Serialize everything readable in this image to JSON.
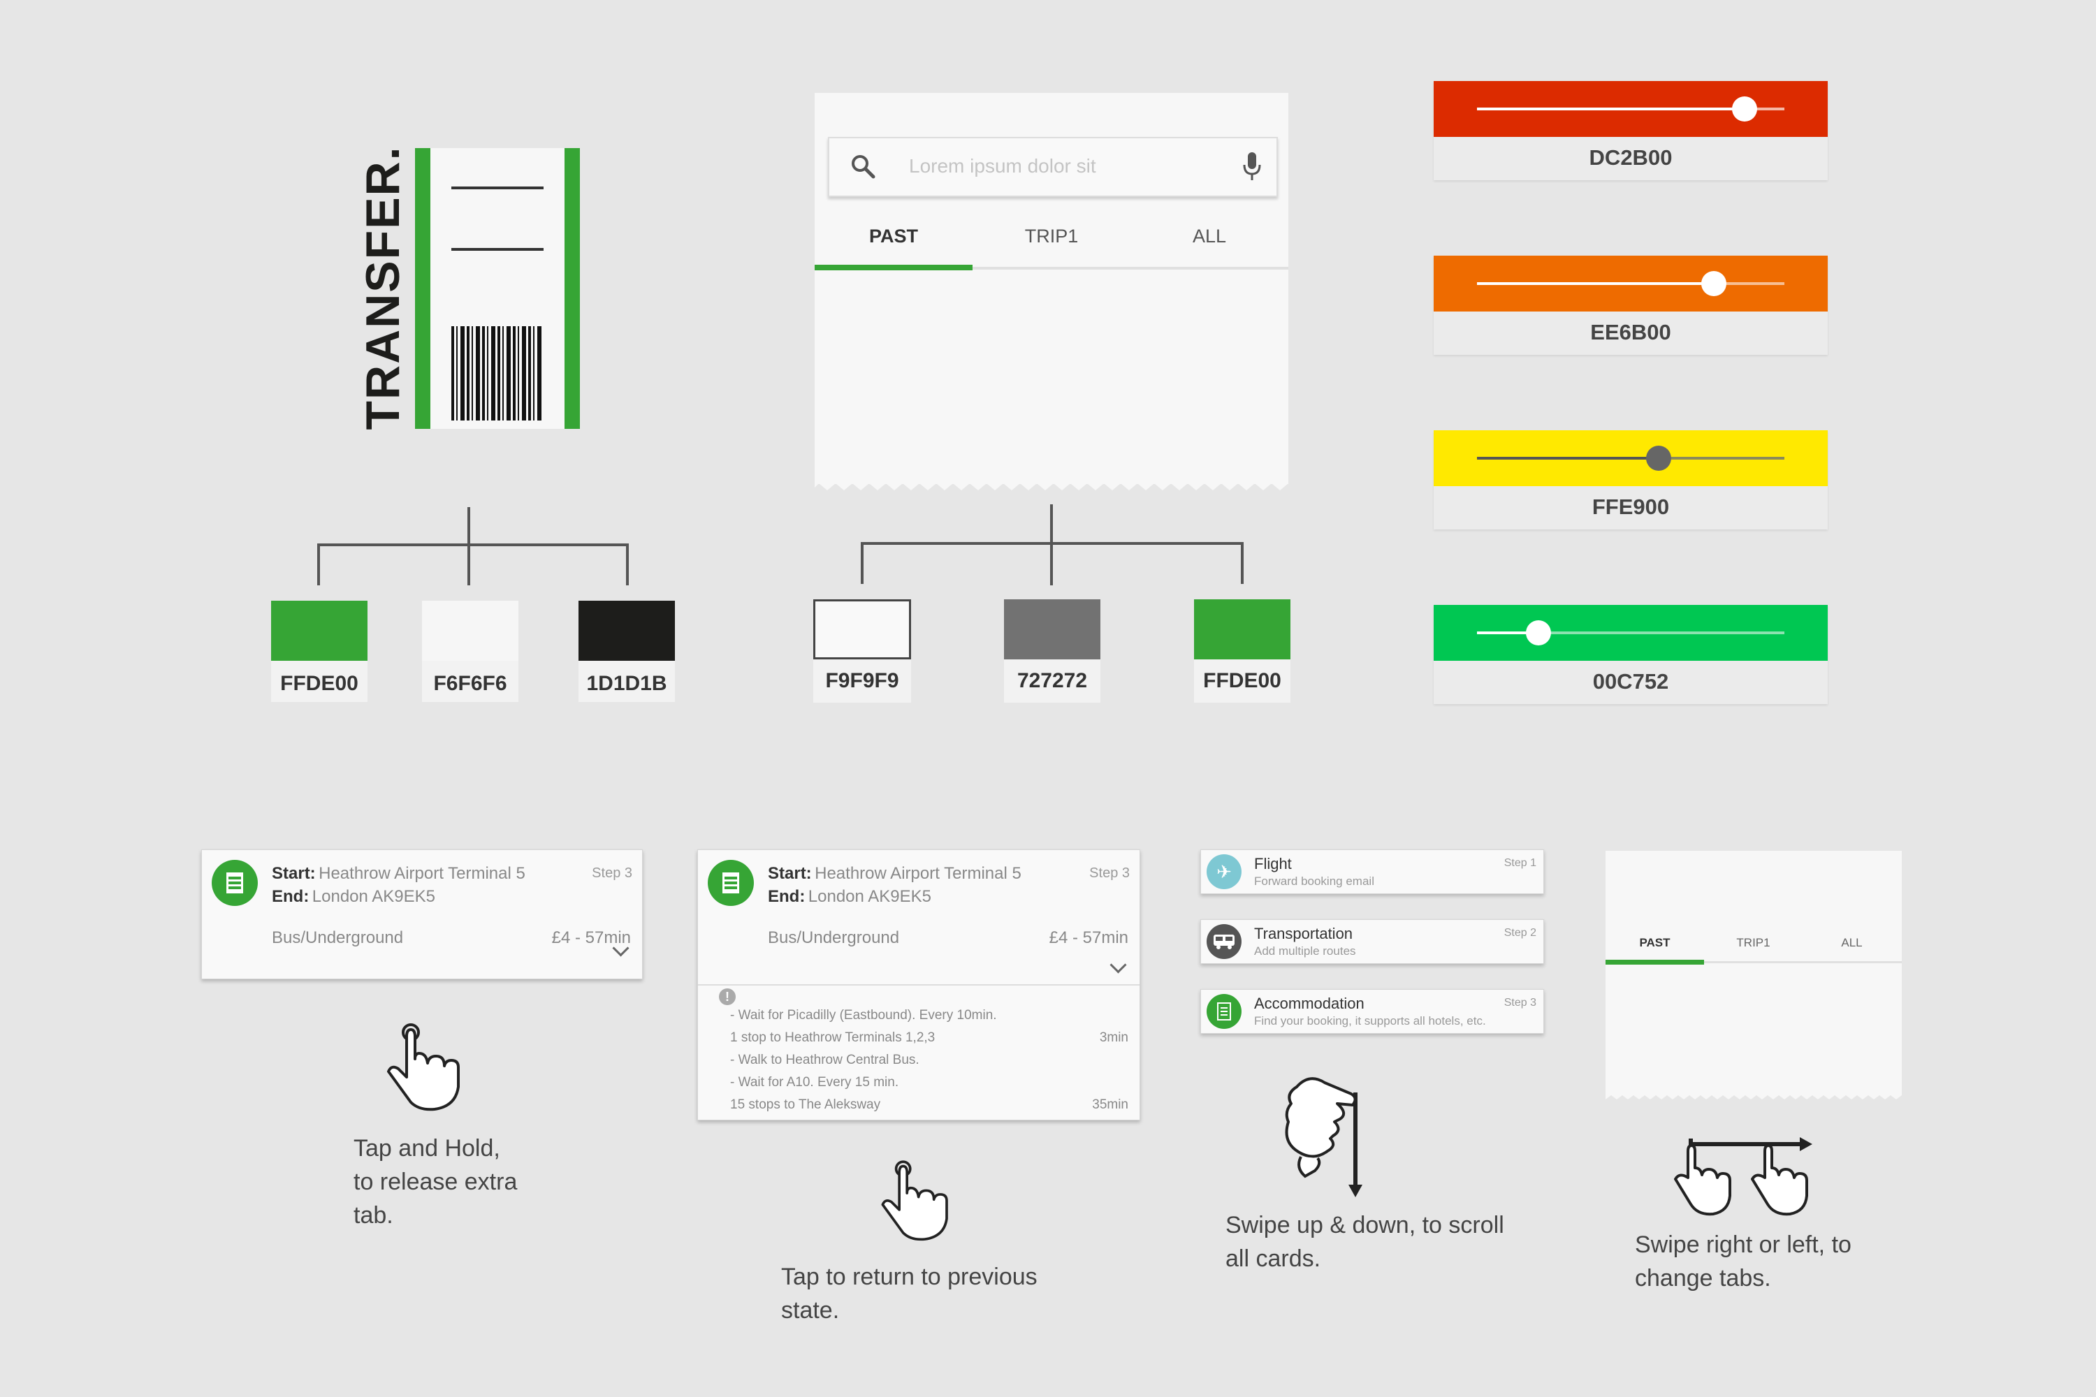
{
  "transfer": {
    "title": "TRANSFER."
  },
  "swatches_left": [
    {
      "hex": "FFDE00",
      "color": "#36a535"
    },
    {
      "hex": "F6F6F6",
      "color": "#f6f6f6"
    },
    {
      "hex": "1D1D1B",
      "color": "#1d1d1b"
    }
  ],
  "swatches_mid": [
    {
      "hex": "F9F9F9",
      "color": "#f9f9f9"
    },
    {
      "hex": "727272",
      "color": "#727272"
    },
    {
      "hex": "FFDE00",
      "color": "#36a535"
    }
  ],
  "search": {
    "placeholder": "Lorem ipsum dolor sit",
    "tabs": [
      "PAST",
      "TRIP1",
      "ALL"
    ],
    "active_tab": "PAST"
  },
  "sliders": [
    {
      "hex": "DC2B00",
      "color": "#dc2b00",
      "value": 0.87
    },
    {
      "hex": "EE6B00",
      "color": "#ee6b00",
      "value": 0.77
    },
    {
      "hex": "FFE900",
      "color": "#ffe900",
      "value": 0.59
    },
    {
      "hex": "00C752",
      "color": "#00c752",
      "value": 0.2
    }
  ],
  "route_card": {
    "start_label": "Start:",
    "start_value": "Heathrow Airport Terminal 5",
    "end_label": "End:",
    "end_value": "London AK9EK5",
    "step": "Step 3",
    "mode": "Bus/Underground",
    "price": "£4 - 57min"
  },
  "route_details": [
    {
      "text": "- Wait for Picadilly (Eastbound).  Every 10min.",
      "time": ""
    },
    {
      "text": "   1 stop to Heathrow Terminals 1,2,3",
      "time": "3min"
    },
    {
      "text": "- Walk to Heathrow Central Bus.",
      "time": ""
    },
    {
      "text": "- Wait for A10.  Every 15 min.",
      "time": ""
    },
    {
      "text": "   15 stops to The Aleksway",
      "time": "35min"
    }
  ],
  "booking_cards": [
    {
      "title": "Flight",
      "subtitle": "Forward booking email",
      "step": "Step 1",
      "color": "#7ec8d3",
      "icon": "plane-icon"
    },
    {
      "title": "Transportation",
      "subtitle": "Add multiple routes",
      "step": "Step 2",
      "color": "#555555",
      "icon": "bus-icon"
    },
    {
      "title": "Accommodation",
      "subtitle": "Find your booking, it supports all hotels, etc.",
      "step": "Step 3",
      "color": "#36a535",
      "icon": "document-icon"
    }
  ],
  "mini_tabs": [
    "PAST",
    "TRIP1",
    "ALL"
  ],
  "captions": {
    "tap_hold": [
      "Tap and Hold,",
      "to release extra",
      "tab."
    ],
    "tap_return": [
      "Tap to return to previous",
      "state."
    ],
    "swipe_updown": [
      "Swipe up & down, to scroll",
      "all cards."
    ],
    "swipe_lr": [
      "Swipe right or left, to",
      "change tabs."
    ]
  }
}
